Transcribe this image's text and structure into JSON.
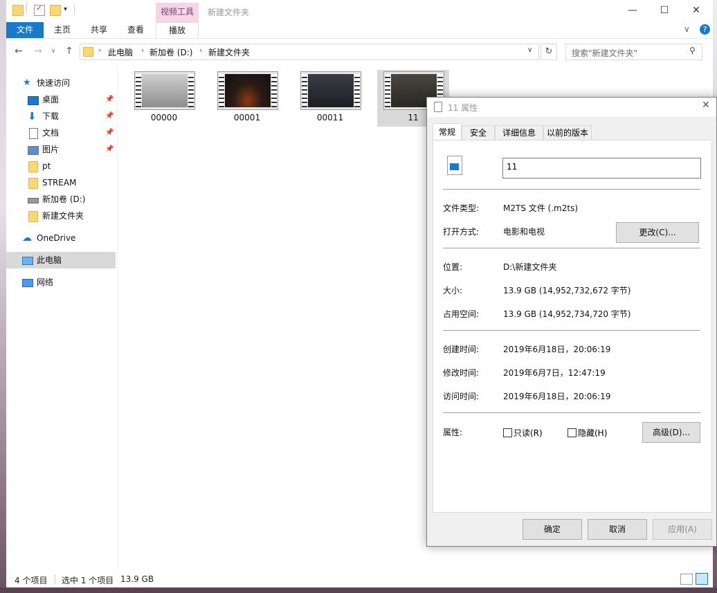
{
  "window": {
    "title": "新建文件夹",
    "contextual_tab": "视频工具",
    "minimize": "—",
    "maximize": "☐",
    "close": "✕"
  },
  "ribbon": {
    "tabs": [
      "文件",
      "主页",
      "共享",
      "查看",
      "播放"
    ],
    "collapse": "∨",
    "help": "?"
  },
  "address": {
    "crumbs": [
      "此电脑",
      "新加卷 (D:)",
      "新建文件夹"
    ],
    "search_placeholder": "搜索\"新建文件夹\""
  },
  "nav": {
    "quick_access": "快速访问",
    "items": [
      "桌面",
      "下载",
      "文档",
      "图片",
      "pt",
      "STREAM",
      "新加卷 (D:)",
      "新建文件夹"
    ],
    "onedrive": "OneDrive",
    "this_pc": "此电脑",
    "network": "网络"
  },
  "files": [
    {
      "name": "00000"
    },
    {
      "name": "00001"
    },
    {
      "name": "00011"
    },
    {
      "name": "11"
    }
  ],
  "status": {
    "count": "4 个项目",
    "selected": "选中 1 个项目",
    "size": "13.9 GB"
  },
  "properties": {
    "title": "11 属性",
    "tabs": [
      "常规",
      "安全",
      "详细信息",
      "以前的版本"
    ],
    "name": "11",
    "type_label": "文件类型:",
    "type_value": "M2TS 文件 (.m2ts)",
    "open_label": "打开方式:",
    "open_value": "电影和电视",
    "change_btn": "更改(C)...",
    "location_label": "位置:",
    "location_value": "D:\\新建文件夹",
    "size_label": "大小:",
    "size_value": "13.9 GB (14,952,732,672 字节)",
    "disk_label": "占用空间:",
    "disk_value": "13.9 GB (14,952,734,720 字节)",
    "created_label": "创建时间:",
    "created_value": "2019年6月18日，20:06:19",
    "modified_label": "修改时间:",
    "modified_value": "2019年6月7日，12:47:19",
    "accessed_label": "访问时间:",
    "accessed_value": "2019年6月18日，20:06:19",
    "attr_label": "属性:",
    "readonly": "只读(R)",
    "hidden": "隐藏(H)",
    "advanced_btn": "高级(D)...",
    "ok": "确定",
    "cancel": "取消",
    "apply": "应用(A)"
  }
}
